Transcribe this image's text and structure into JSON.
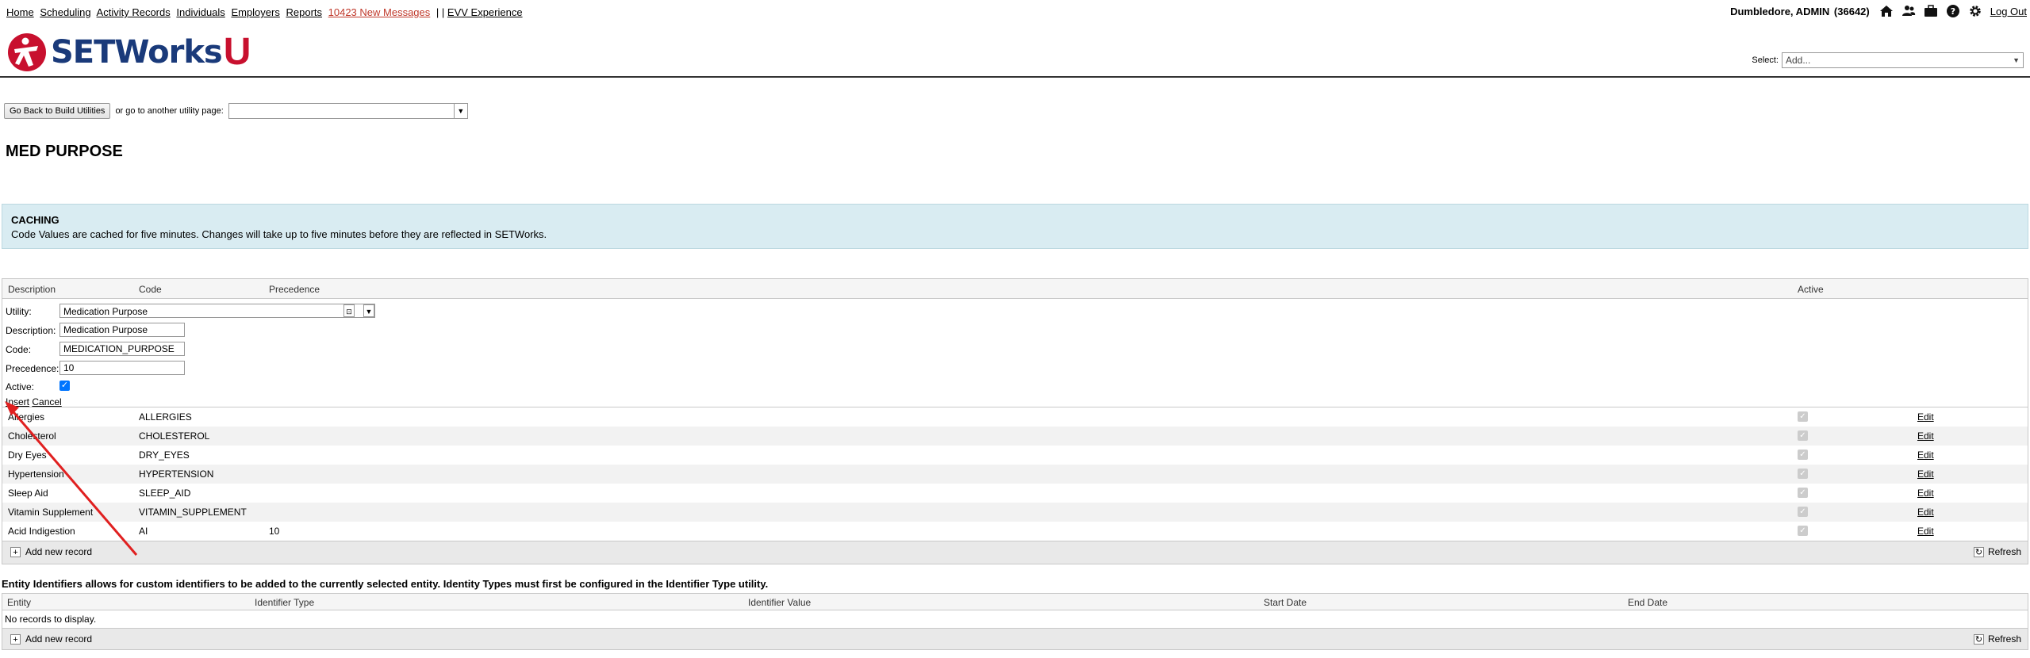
{
  "topnav": {
    "links": [
      "Home",
      "Scheduling",
      "Activity Records",
      "Individuals",
      "Employers",
      "Reports"
    ],
    "messages": "10423 New Messages",
    "sep": "| |",
    "evv": "EVV Experience",
    "user": "Dumbledore, ADMIN",
    "user_id": "(36642)",
    "logout": "Log Out",
    "icons": [
      "home-icon",
      "users-icon",
      "briefcase-icon",
      "help-icon",
      "gear-icon"
    ]
  },
  "header": {
    "logo": "SETWorks",
    "logo_u": "U",
    "select_label": "Select:",
    "select_value": "Add..."
  },
  "nav": {
    "back_button": "Go Back to Build Utilities",
    "other_text": "or go to another utility page:"
  },
  "page_title": "MED PURPOSE",
  "caching": {
    "title": "CACHING",
    "text": "Code Values are cached for five minutes. Changes will take up to five minutes before they are reflected in SETWorks."
  },
  "grid": {
    "columns": {
      "description": "Description",
      "code": "Code",
      "precedence": "Precedence",
      "active": "Active"
    },
    "form": {
      "utility_label": "Utility:",
      "utility_value": "Medication Purpose",
      "description_label": "Description:",
      "description_value": "Medication Purpose",
      "code_label": "Code:",
      "code_value": "MEDICATION_PURPOSE",
      "precedence_label": "Precedence:",
      "precedence_value": "10",
      "active_label": "Active:",
      "insert": "Insert",
      "cancel": "Cancel"
    },
    "rows": [
      {
        "description": "Allergies",
        "code": "ALLERGIES",
        "precedence": "",
        "edit": "Edit"
      },
      {
        "description": "Cholesterol",
        "code": "CHOLESTEROL",
        "precedence": "",
        "edit": "Edit"
      },
      {
        "description": "Dry Eyes",
        "code": "DRY_EYES",
        "precedence": "",
        "edit": "Edit"
      },
      {
        "description": "Hypertension",
        "code": "HYPERTENSION",
        "precedence": "",
        "edit": "Edit"
      },
      {
        "description": "Sleep Aid",
        "code": "SLEEP_AID",
        "precedence": "",
        "edit": "Edit"
      },
      {
        "description": "Vitamin Supplement",
        "code": "VITAMIN_SUPPLEMENT",
        "precedence": "",
        "edit": "Edit"
      },
      {
        "description": "Acid Indigestion",
        "code": "AI",
        "precedence": "10",
        "edit": "Edit"
      }
    ],
    "add_new": "Add new record",
    "refresh": "Refresh"
  },
  "identifiers": {
    "description": "Entity Identifiers allows for custom identifiers to be added to the currently selected entity. Identity Types must first be configured in the Identifier Type utility.",
    "columns": {
      "entity": "Entity",
      "type": "Identifier Type",
      "value": "Identifier Value",
      "start": "Start Date",
      "end": "End Date"
    },
    "empty": "No records to display.",
    "add_new": "Add new record",
    "refresh": "Refresh"
  },
  "colors": {
    "link_red": "#c0392b",
    "caching_bg": "#d9ecf2",
    "logo_blue": "#1a3a7a",
    "logo_red": "#c8102e",
    "annotation_arrow": "#e02020"
  }
}
